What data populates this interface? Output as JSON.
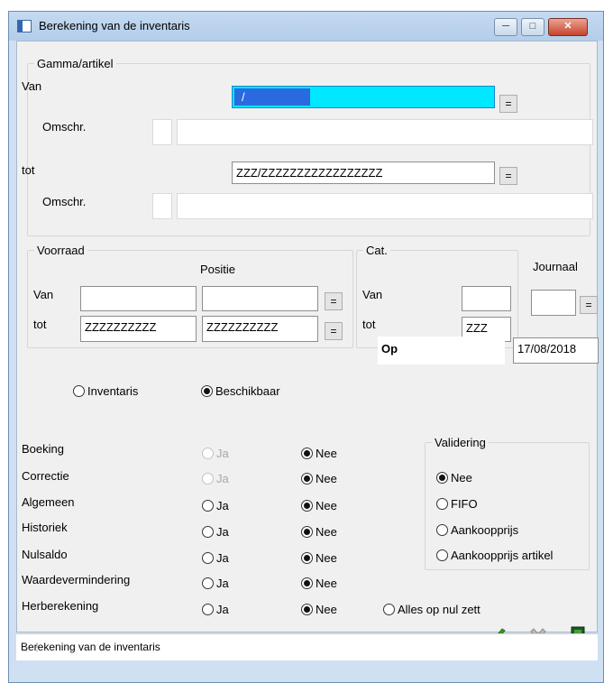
{
  "window": {
    "title": "Berekening van de inventaris",
    "status": "Berekening van de inventaris"
  },
  "gamma": {
    "legend": "Gamma/artikel",
    "van_label": "Van",
    "van_value": "/",
    "omschr_label": "Omschr.",
    "tot_label": "tot",
    "tot_value": "ZZZ/ZZZZZZZZZZZZZZZZZ",
    "omschr2_label": "Omschr.",
    "eq_label": "="
  },
  "voorraad": {
    "legend": "Voorraad",
    "positie_label": "Positie",
    "van_label": "Van",
    "tot_label": "tot",
    "tot_value": "ZZZZZZZZZZ",
    "tot_positie_value": "ZZZZZZZZZZ"
  },
  "cat": {
    "legend": "Cat.",
    "van_label": "Van",
    "tot_label": "tot",
    "tot_value": "ZZZ"
  },
  "journaal": {
    "label": "Journaal"
  },
  "op": {
    "label": "Op",
    "date": "17/08/2018"
  },
  "mode": {
    "inventaris": "Inventaris",
    "beschikbaar": "Beschikbaar"
  },
  "options": [
    {
      "label": "Boeking",
      "ja": "Ja",
      "nee": "Nee"
    },
    {
      "label": "Correctie",
      "ja": "Ja",
      "nee": "Nee"
    },
    {
      "label": "Algemeen",
      "ja": "Ja",
      "nee": "Nee"
    },
    {
      "label": "Historiek",
      "ja": "Ja",
      "nee": "Nee"
    },
    {
      "label": "Nulsaldo",
      "ja": "Ja",
      "nee": "Nee"
    },
    {
      "label": "Waardevermindering",
      "ja": "Ja",
      "nee": "Nee"
    },
    {
      "label": "Herberekening",
      "ja": "Ja",
      "nee": "Nee"
    }
  ],
  "alles_op_nul": "Alles op nul zett",
  "validering": {
    "legend": "Validering",
    "nee": "Nee",
    "fifo": "FIFO",
    "aankoopprijs": "Aankoopprijs",
    "aankoopprijs_artikel": "Aankoopprijs artikel"
  },
  "icons": {
    "ok": "checkmark-icon",
    "cancel": "x-icon",
    "exit": "exit-door-icon"
  },
  "colors": {
    "highlight": "#00e8ff",
    "selection": "#2a6ae0",
    "ok_green": "#3f9b1c"
  }
}
